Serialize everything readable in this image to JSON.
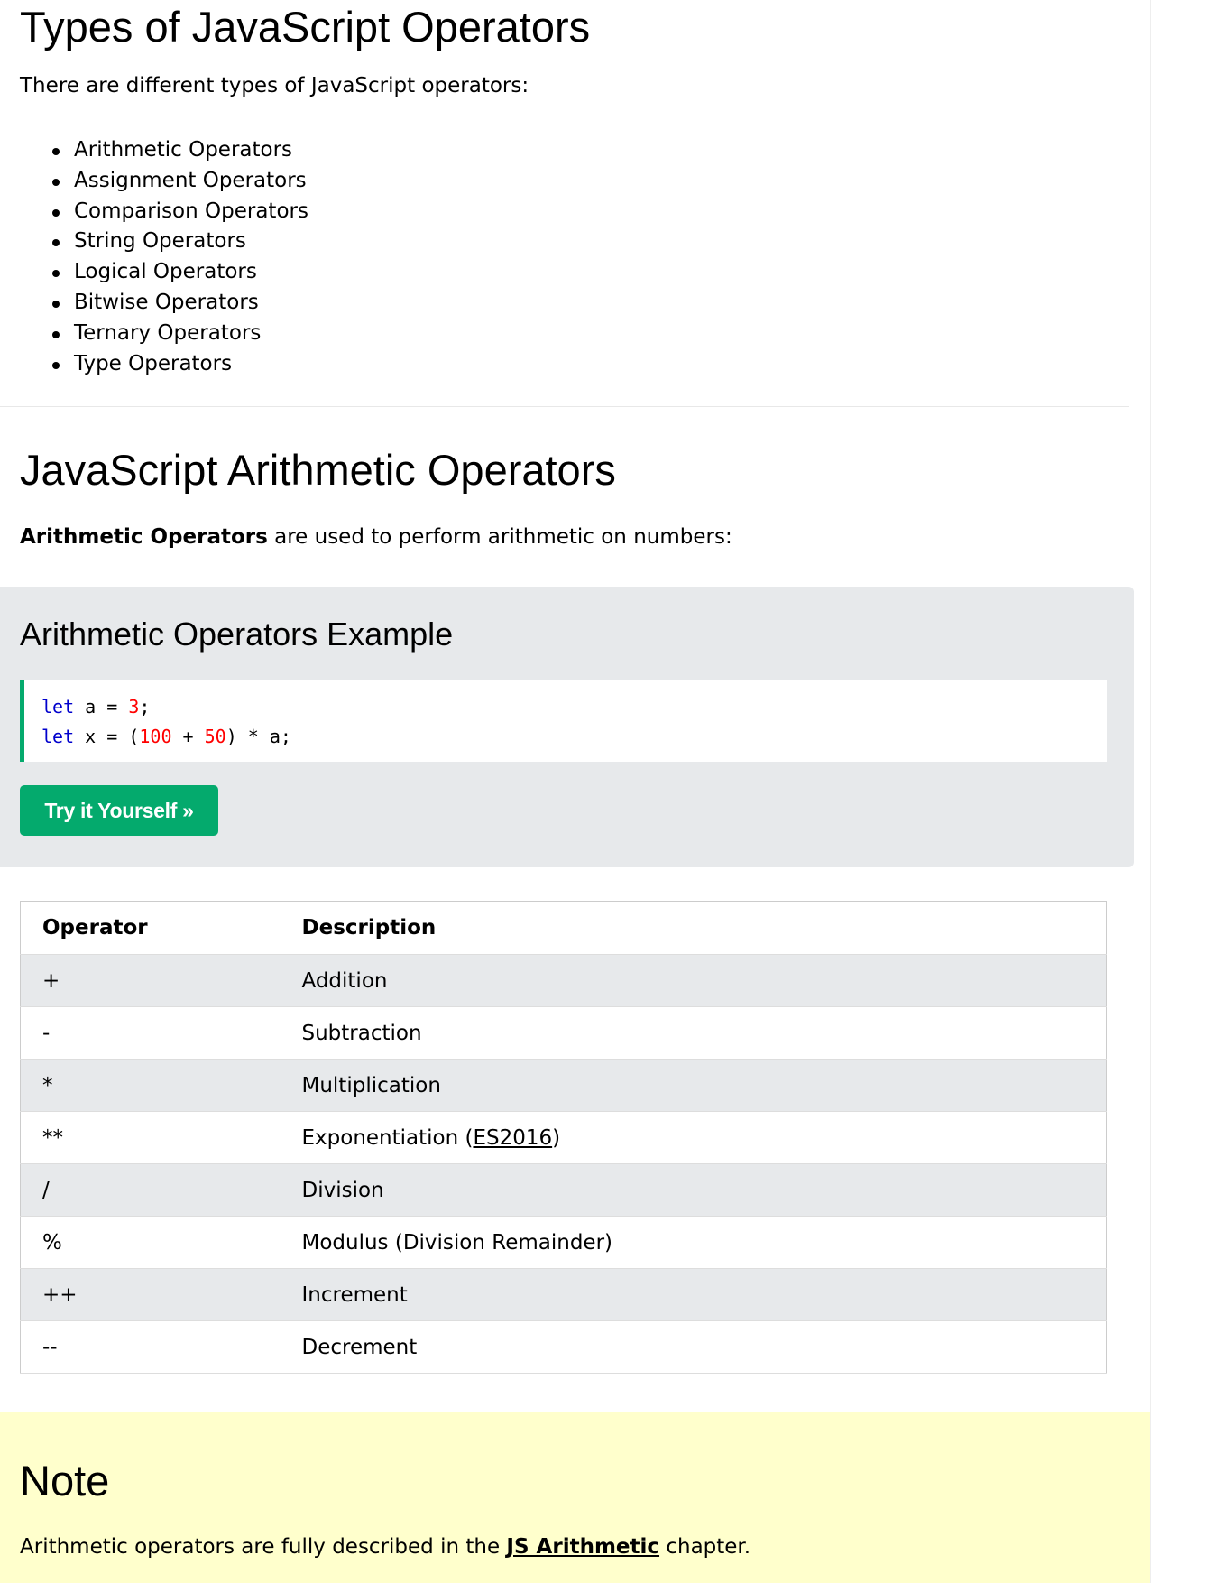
{
  "types_section": {
    "heading": "Types of JavaScript Operators",
    "intro": "There are different types of JavaScript operators:",
    "items": [
      "Arithmetic Operators",
      "Assignment Operators",
      "Comparison Operators",
      "String Operators",
      "Logical Operators",
      "Bitwise Operators",
      "Ternary Operators",
      "Type Operators"
    ]
  },
  "arithmetic_section": {
    "heading": "JavaScript Arithmetic Operators",
    "intro_bold": "Arithmetic Operators",
    "intro_rest": " are used to perform arithmetic on numbers:"
  },
  "example": {
    "title": "Arithmetic Operators Example",
    "code": [
      {
        "kw": "let",
        "ident": " a = ",
        "num1": "3",
        "mid": "",
        "num2": "",
        "rest": ";"
      },
      {
        "kw": "let",
        "ident": " x = (",
        "num1": "100",
        "mid": " + ",
        "num2": "50",
        "rest": ") * a;"
      }
    ],
    "try_button": "Try it Yourself »"
  },
  "table": {
    "headers": [
      "Operator",
      "Description"
    ],
    "rows": [
      {
        "op": "+",
        "desc": "Addition"
      },
      {
        "op": "-",
        "desc": "Subtraction"
      },
      {
        "op": "*",
        "desc": "Multiplication"
      },
      {
        "op": "**",
        "desc": "Exponentiation (",
        "link": "ES2016",
        "desc_after": ")"
      },
      {
        "op": "/",
        "desc": "Division"
      },
      {
        "op": "%",
        "desc": "Modulus (Division Remainder)"
      },
      {
        "op": "++",
        "desc": "Increment"
      },
      {
        "op": "--",
        "desc": "Decrement"
      }
    ]
  },
  "note": {
    "title": "Note",
    "text_before": "Arithmetic operators are fully described in the ",
    "link": "JS Arithmetic",
    "text_after": " chapter."
  },
  "colors": {
    "accent_green": "#04aa6d",
    "example_bg": "#e7e9eb",
    "note_bg": "#ffffcc",
    "code_keyword": "#0000cd",
    "code_number": "#ff0000"
  }
}
